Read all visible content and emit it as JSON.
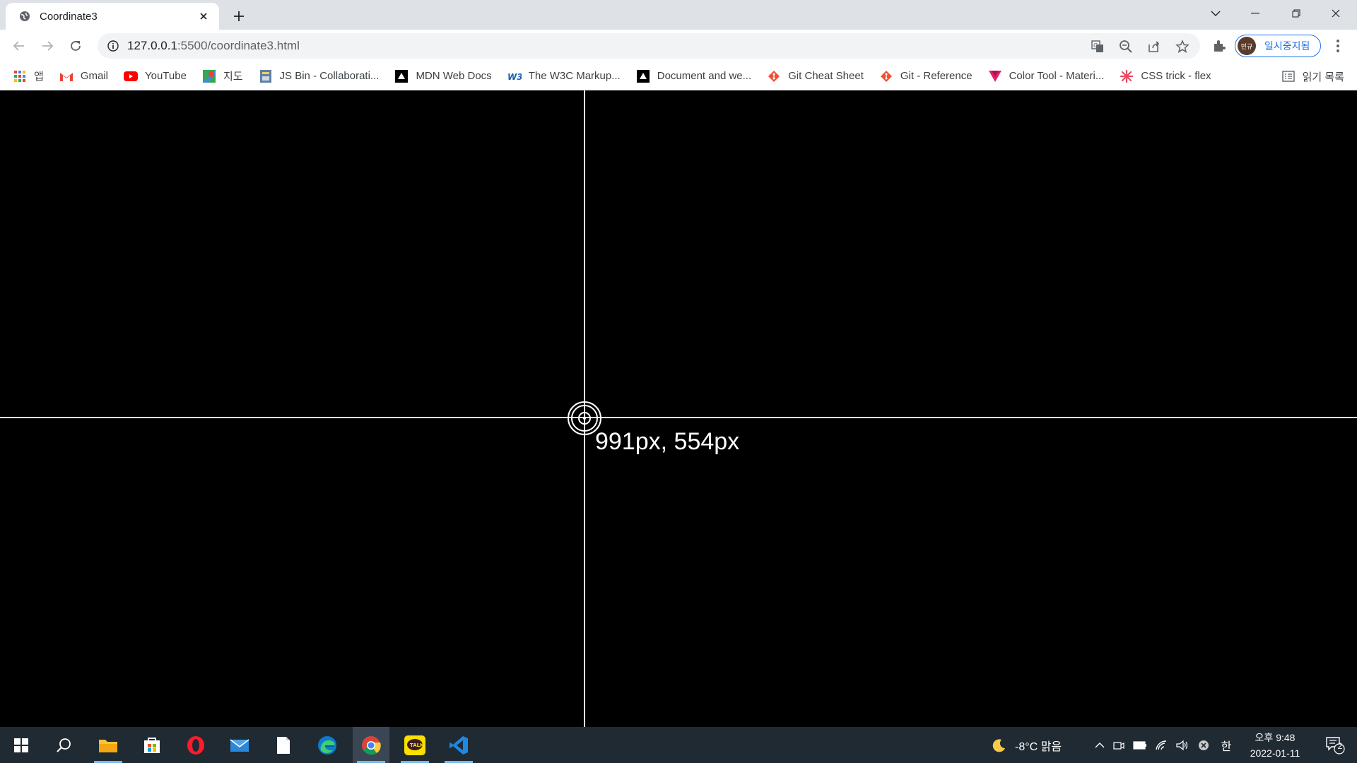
{
  "browser": {
    "tab": {
      "title": "Coordinate3",
      "favicon": "globe-icon"
    },
    "new_tab_icon": "plus-icon",
    "window_controls": [
      "chevron-down-icon",
      "minimize-icon",
      "restore-icon",
      "close-icon"
    ]
  },
  "toolbar": {
    "url_host": "127.0.0.1",
    "url_rest": ":5500/coordinate3.html",
    "profile_avatar_text": "민규",
    "profile_label": "일시중지됨"
  },
  "bookmarks": [
    {
      "label": "앱",
      "icon": "apps-grid-icon"
    },
    {
      "label": "Gmail",
      "icon": "gmail-icon"
    },
    {
      "label": "YouTube",
      "icon": "youtube-icon"
    },
    {
      "label": "지도",
      "icon": "maps-icon"
    },
    {
      "label": "JS Bin - Collaborati...",
      "icon": "jsbin-icon"
    },
    {
      "label": "MDN Web Docs",
      "icon": "mdn-icon"
    },
    {
      "label": "The W3C Markup...",
      "icon": "w3c-icon"
    },
    {
      "label": "Document and we...",
      "icon": "mdn-icon"
    },
    {
      "label": "Git Cheat Sheet",
      "icon": "git-icon"
    },
    {
      "label": "Git - Reference",
      "icon": "git-icon"
    },
    {
      "label": "Color Tool - Materi...",
      "icon": "material-icon"
    },
    {
      "label": "CSS trick - flex",
      "icon": "css-tricks-icon"
    }
  ],
  "reading_list": {
    "label": "읽기 목록",
    "icon": "reading-list-icon"
  },
  "page": {
    "coordinates_text": "991px, 554px",
    "background": "#000000",
    "line_color": "#e0e0e0"
  },
  "taskbar": {
    "apps": [
      "windows-start-icon",
      "search-icon",
      "file-explorer-icon",
      "microsoft-store-icon",
      "opera-icon",
      "mail-icon",
      "notepad-icon",
      "edge-icon",
      "chrome-icon",
      "kakaotalk-icon",
      "vscode-icon"
    ],
    "weather": "-8°C 맑음",
    "ime": "한",
    "time": "오후 9:48",
    "date": "2022-01-11",
    "notification_count": "2"
  }
}
